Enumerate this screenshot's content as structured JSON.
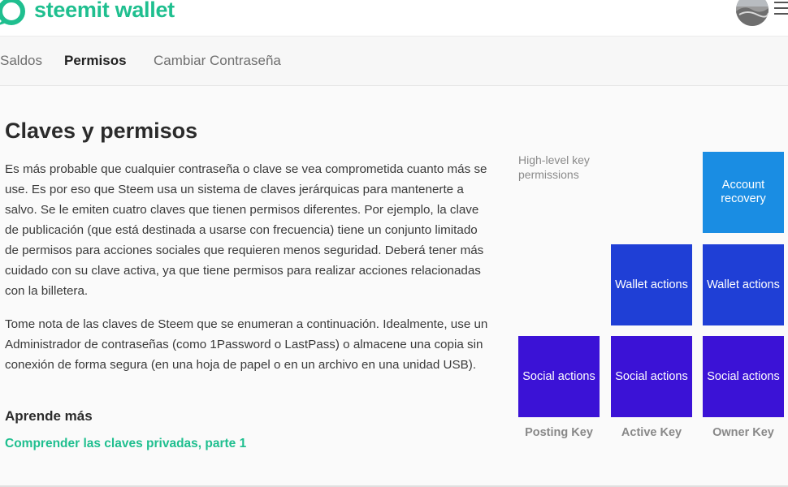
{
  "header": {
    "logo_text": "steemit wallet",
    "brand_color": "#1fbf8f"
  },
  "tabs": [
    {
      "label": "Saldos",
      "active": false
    },
    {
      "label": "Permisos",
      "active": true
    },
    {
      "label": "Cambiar Contraseña",
      "active": false
    }
  ],
  "main": {
    "title": "Claves y permisos",
    "paragraph1": "Es más probable que cualquier contraseña o clave se vea comprometida cuanto más se use. Es por eso que Steem usa un sistema de claves jerárquicas para mantenerte a salvo. Se le emiten cuatro claves que tienen permisos diferentes. Por ejemplo, la clave de publicación (que está destinada a usarse con frecuencia) tiene un conjunto limitado de permisos para acciones sociales que requieren menos seguridad. Deberá tener más cuidado con su clave activa, ya que tiene permisos para realizar acciones relacionadas con la billetera.",
    "paragraph2": "Tome nota de las claves de Steem que se enumeran a continuación. Idealmente, use un Administrador de contraseñas (como 1Password o LastPass) o almacene una copia sin conexión de forma segura (en una hoja de papel o en un archivo en una unidad USB).",
    "learn_more_heading": "Aprende más",
    "learn_more_link": "Comprender las claves privadas, parte 1"
  },
  "diagram": {
    "label": "High-level key permissions",
    "boxes": {
      "account_recovery": "Account recovery",
      "wallet_actions": "Wallet actions",
      "social_actions": "Social actions"
    },
    "keys": {
      "posting": "Posting Key",
      "active": "Active Key",
      "owner": "Owner Key"
    },
    "colors": {
      "account_recovery": "#1a8de3",
      "wallet": "#1f3fd6",
      "social": "#3b12d6"
    }
  }
}
